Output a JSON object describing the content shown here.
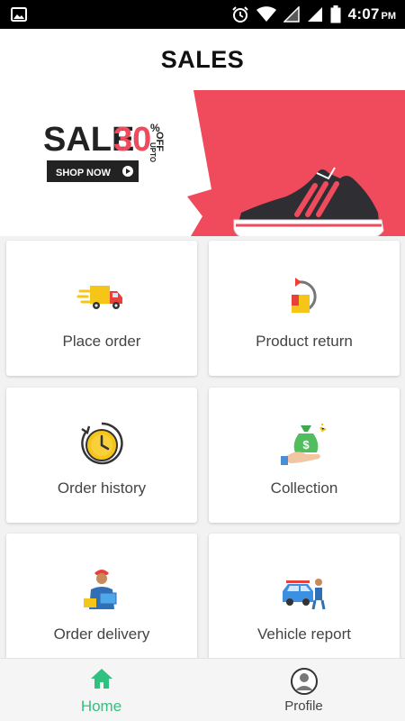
{
  "status_bar": {
    "time": "4:07",
    "ampm": "PM"
  },
  "header": {
    "title": "SALES"
  },
  "banner": {
    "sale_text": "SALE",
    "discount": "30",
    "upto": "UPTO",
    "percent": "%",
    "off": "OFF",
    "cta": "SHOP NOW",
    "accent_color": "#f04a5d"
  },
  "menu": [
    {
      "label": "Place order",
      "icon": "delivery-truck-icon"
    },
    {
      "label": "Product return",
      "icon": "product-return-icon"
    },
    {
      "label": "Order history",
      "icon": "clock-history-icon"
    },
    {
      "label": "Collection",
      "icon": "money-bag-icon"
    },
    {
      "label": "Order delivery",
      "icon": "delivery-man-icon"
    },
    {
      "label": "Vehicle report",
      "icon": "vehicle-repair-icon"
    }
  ],
  "bottom_nav": {
    "home": {
      "label": "Home",
      "icon": "home-icon",
      "active": true,
      "color": "#2ec27e"
    },
    "profile": {
      "label": "Profile",
      "icon": "user-avatar-icon"
    }
  }
}
